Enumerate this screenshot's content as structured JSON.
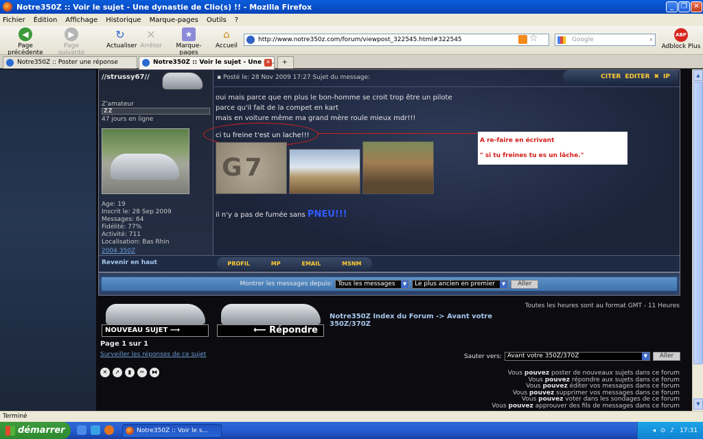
{
  "window": {
    "title": "Notre350Z :: Voir le sujet - Une dynastie de Clio(s) !! - Mozilla Firefox"
  },
  "menu": [
    "Fichier",
    "Édition",
    "Affichage",
    "Historique",
    "Marque-pages",
    "Outils",
    "?"
  ],
  "nav": {
    "back": "Page précédente",
    "forward": "Page suivante",
    "reload": "Actualiser",
    "stop": "Arrêter",
    "bookmarks": "Marque-pages",
    "home": "Accueil",
    "url": "http://www.notre350z.com/forum/viewpost_322545.html#322545",
    "search_placeholder": "Google",
    "adblock": "Adblock Plus",
    "adblock_badge": "ABP"
  },
  "tabs": [
    {
      "label": "Notre350Z :: Poster une réponse"
    },
    {
      "label": "Notre350Z :: Voir le sujet - Une d..."
    }
  ],
  "post": {
    "username": "//strussy67//",
    "rank_title": "Z'amateur",
    "rank_badge": "ZZ",
    "online": "47 jours en ligne",
    "stats": [
      "Age: 19",
      "Inscrit le: 28 Sep 2009",
      "Messages: 64",
      "Fidélité: 77%",
      "Activité: 711",
      "Localisation: Bas Rhin"
    ],
    "user_link": "2004 350Z",
    "header": "Posté le: 28 Nov 2009 17:27     Sujet du message:",
    "btn_quote": "CITER",
    "btn_edit": "EDITER",
    "btn_ip": "IP",
    "message_lines": [
      "oui mais parce que en plus le bon-homme se croit trop être un pilote",
      "parce qu'il fait de la compet en kart",
      "mais en voiture même ma grand mère roule mieux mdr!!!"
    ],
    "highlight": "ci tu freine t'est un lache!!!",
    "note_line1": "A re-faire en écrivant",
    "note_line2": "\" si tu freines tu es un lâche.\"",
    "photo1_text": "G7",
    "tagline": "il n'y a pas de fumée sans ",
    "tagline_bold": "PNEU!!!",
    "back_top": "Revenir en haut",
    "profile_buttons": [
      "PROFIL",
      "MP",
      "EMAIL",
      "MSNM"
    ]
  },
  "filter": {
    "label": "Montrer les messages depuis:",
    "option1": "Tous les messages",
    "option2": "Le plus ancien en premier",
    "go": "Aller"
  },
  "footer": {
    "timezone": "Toutes les heures sont au format GMT - 11 Heures",
    "new_topic": "NOUVEAU SUJET",
    "reply": "Répondre",
    "breadcrumb": "Notre350Z Index du Forum -> Avant votre 350Z/370Z",
    "page": "Page 1 sur 1",
    "watch": "Surveiller les réponses de ce sujet",
    "jump_label": "Sauter vers:",
    "jump_value": "Avant votre 350Z/370Z",
    "jump_go": "Aller",
    "perms": [
      [
        "Vous ",
        "pouvez",
        " poster de nouveaux sujets dans ce forum"
      ],
      [
        "Vous ",
        "pouvez",
        " répondre aux sujets dans ce forum"
      ],
      [
        "Vous ",
        "pouvez",
        " éditer vos messages dans ce forum"
      ],
      [
        "Vous ",
        "pouvez",
        " supprimer vos messages dans ce forum"
      ],
      [
        "Vous ",
        "pouvez",
        " voter dans les sondages de ce forum"
      ],
      [
        "Vous ",
        "pouvez",
        " approuver des fils de messages dans ce forum"
      ]
    ]
  },
  "status": "Terminé",
  "taskbar": {
    "start": "démarrer",
    "item": "Notre350Z :: Voir le s...",
    "clock": "17:31"
  }
}
